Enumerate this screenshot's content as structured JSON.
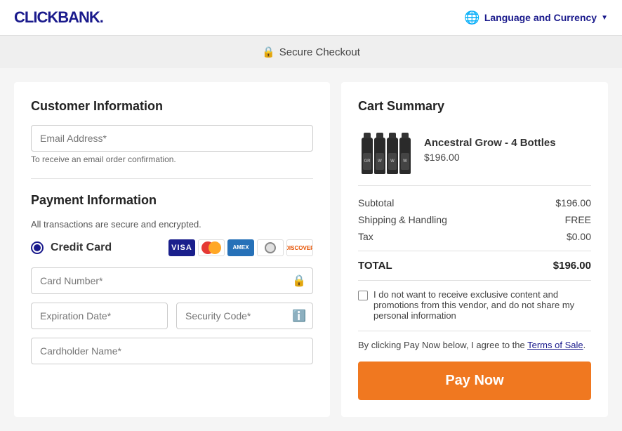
{
  "header": {
    "logo": "CLICKBANK.",
    "language_currency_label": "Language and Currency"
  },
  "secure_banner": {
    "text": "Secure Checkout"
  },
  "left_col": {
    "customer_section_title": "Customer Information",
    "email_label": "Email Address*",
    "email_placeholder": "Email Address*",
    "email_hint": "To receive an email order confirmation.",
    "payment_section_title": "Payment Information",
    "payment_subtitle": "All transactions are secure and encrypted.",
    "credit_card_label": "Credit Card",
    "card_number_placeholder": "Card Number*",
    "expiration_placeholder": "Expiration Date*",
    "security_placeholder": "Security Code*",
    "cardholder_placeholder": "Cardholder Name*"
  },
  "right_col": {
    "cart_title": "Cart Summary",
    "product_name": "Ancestral Grow - 4 Bottles",
    "product_price": "$196.00",
    "subtotal_label": "Subtotal",
    "subtotal_value": "$196.00",
    "shipping_label": "Shipping & Handling",
    "shipping_value": "FREE",
    "tax_label": "Tax",
    "tax_value": "$0.00",
    "total_label": "TOTAL",
    "total_value": "$196.00",
    "optout_text": "I do not want to receive exclusive content and promotions from this vendor, and do not share my personal information",
    "terms_prefix": "By clicking Pay Now below, I agree to the ",
    "terms_link": "Terms of Sale",
    "terms_suffix": ".",
    "pay_now_label": "Pay Now"
  },
  "card_brands": [
    {
      "name": "visa",
      "label": "VISA"
    },
    {
      "name": "mastercard",
      "label": "MC"
    },
    {
      "name": "amex",
      "label": "AMEX"
    },
    {
      "name": "diners",
      "label": "D"
    },
    {
      "name": "discover",
      "label": "DISCOVER"
    }
  ]
}
